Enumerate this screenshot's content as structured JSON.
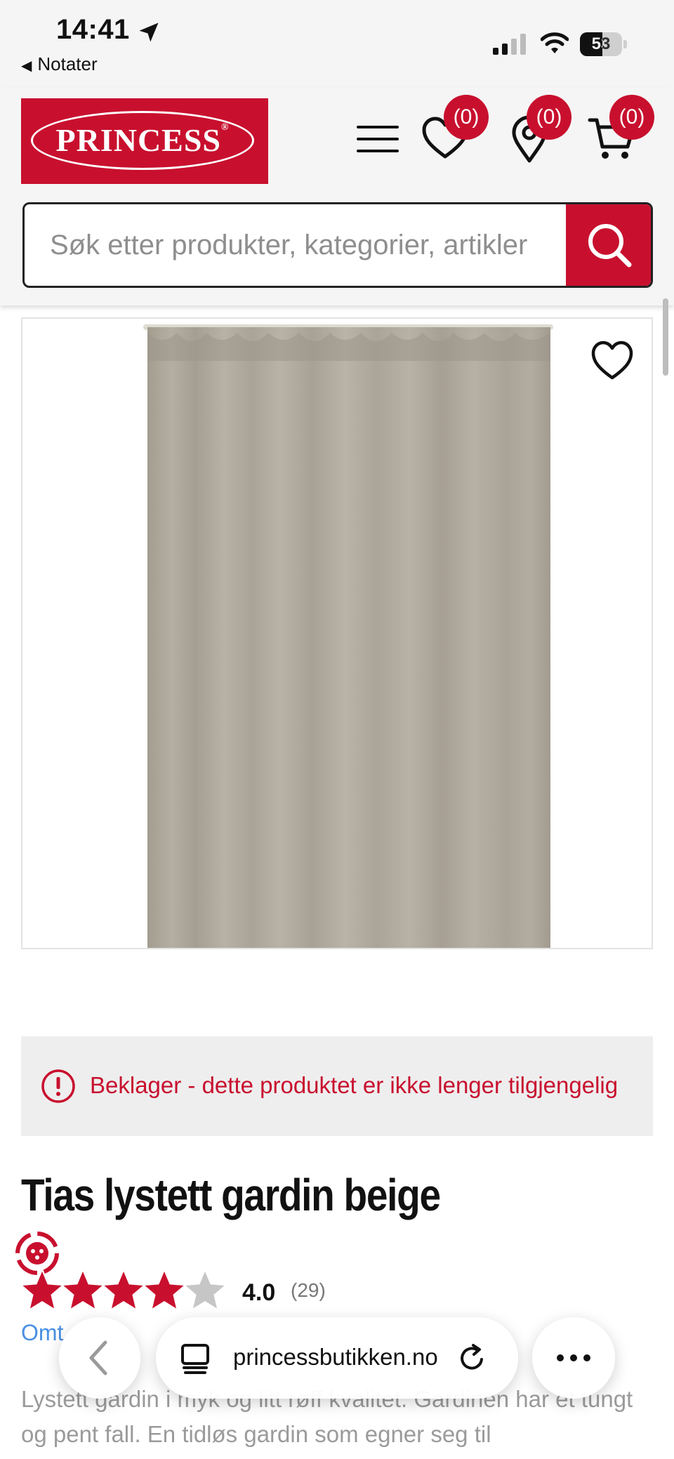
{
  "status_bar": {
    "time": "14:41",
    "back_app": "Notater",
    "battery": "53",
    "battery_level": 0.53
  },
  "header": {
    "logo_text": "PRINCESS",
    "wishlist_count": "(0)",
    "stores_count": "(0)",
    "cart_count": "(0)",
    "accent_color": "#c8102e"
  },
  "search": {
    "placeholder": "Søk etter produkter, kategorier, artikler"
  },
  "product": {
    "unavailable_notice": "Beklager - dette produktet er ikke lenger tilgjengelig",
    "title": "Tias lystett gardin beige",
    "rating_value": "4.0",
    "rating_count": "(29)",
    "rating": 4,
    "reviews_link": "Omt",
    "description": "Lystett gardin i myk og litt røff kvalitet. Gardinen har et tungt og pent fall. En tidløs gardin som egner seg til"
  },
  "browser": {
    "url": "princessbutikken.no"
  },
  "icons": [
    "location-arrow-icon",
    "signal-icon",
    "wifi-icon",
    "battery-icon",
    "menu-icon",
    "heart-icon",
    "store-pin-icon",
    "cart-icon",
    "search-icon",
    "alert-icon",
    "star-icon",
    "chat-icon",
    "chevron-left-icon",
    "tabs-icon",
    "reload-icon",
    "more-icon"
  ]
}
